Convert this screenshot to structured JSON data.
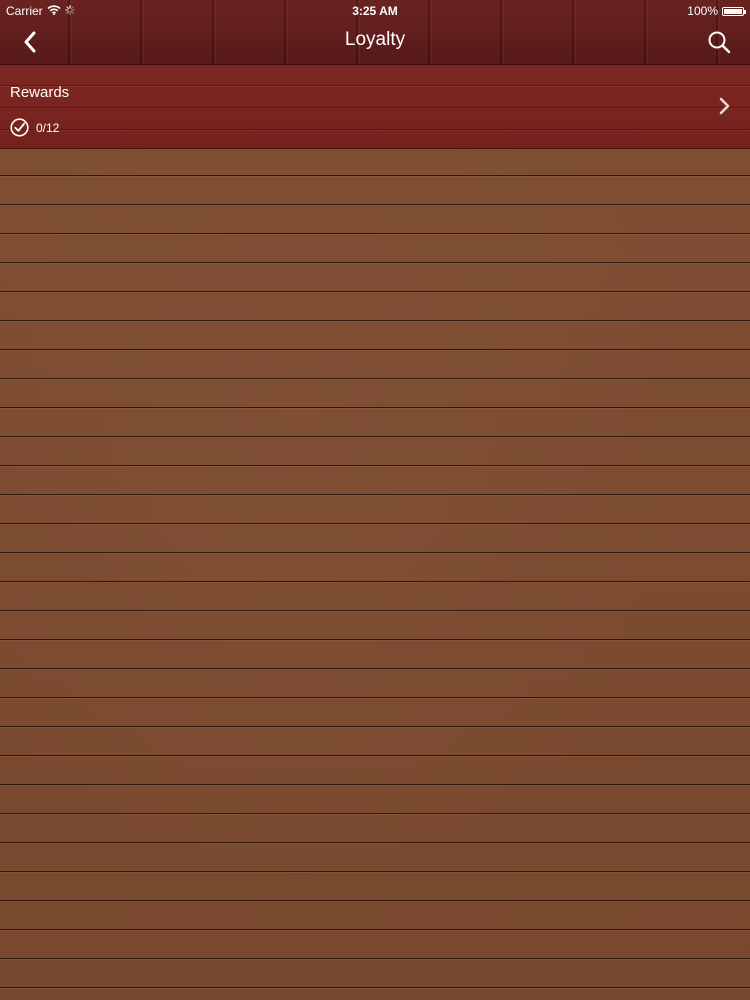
{
  "status_bar": {
    "carrier": "Carrier",
    "time": "3:25 AM",
    "battery": "100%",
    "battery_level": 1.0,
    "icons": [
      "wifi-icon",
      "activity-spinner-icon",
      "battery-icon"
    ]
  },
  "nav": {
    "title": "Loyalty",
    "back_icon": "chevron-left-icon",
    "search_icon": "search-icon"
  },
  "rewards": {
    "title": "Rewards",
    "progress": "0/12",
    "progress_icon": "checkmark-circle-icon",
    "disclosure_icon": "chevron-right-icon"
  },
  "colors": {
    "header": "#5c1c18",
    "rewards_row": "#7c2520",
    "wood": "#7a4a30",
    "text": "#ffffff"
  }
}
